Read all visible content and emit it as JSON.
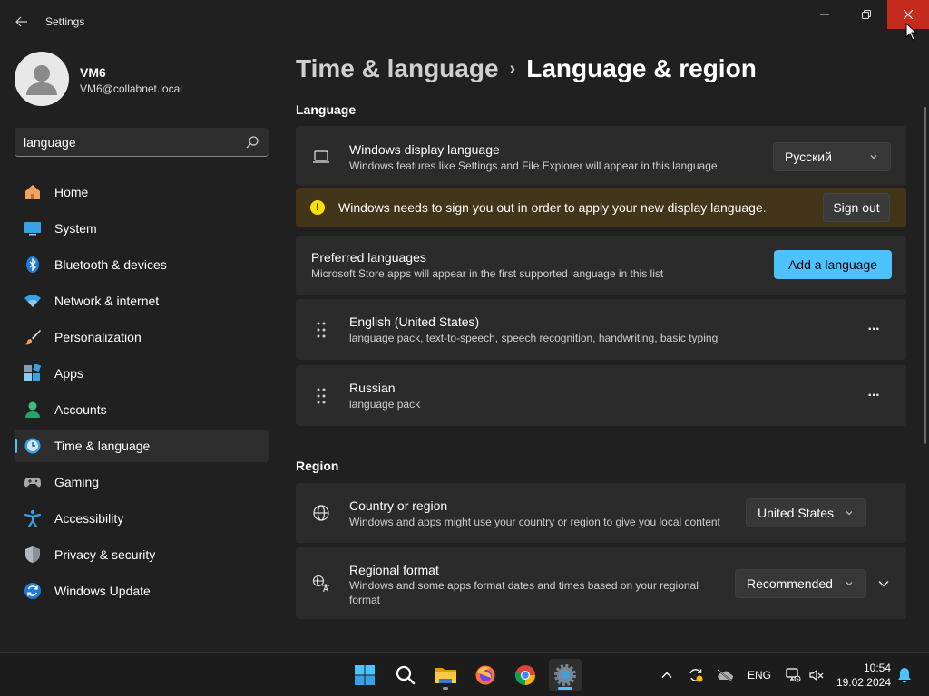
{
  "window": {
    "title": "Settings"
  },
  "user": {
    "name": "VM6",
    "email": "VM6@collabnet.local"
  },
  "search": {
    "value": "language"
  },
  "sidebar": {
    "items": [
      {
        "label": "Home",
        "icon": "home-icon"
      },
      {
        "label": "System",
        "icon": "system-icon"
      },
      {
        "label": "Bluetooth & devices",
        "icon": "bluetooth-icon"
      },
      {
        "label": "Network & internet",
        "icon": "wifi-icon"
      },
      {
        "label": "Personalization",
        "icon": "brush-icon"
      },
      {
        "label": "Apps",
        "icon": "apps-icon"
      },
      {
        "label": "Accounts",
        "icon": "accounts-icon"
      },
      {
        "label": "Time & language",
        "icon": "time-language-icon",
        "active": true
      },
      {
        "label": "Gaming",
        "icon": "gamepad-icon"
      },
      {
        "label": "Accessibility",
        "icon": "accessibility-icon"
      },
      {
        "label": "Privacy & security",
        "icon": "shield-icon"
      },
      {
        "label": "Windows Update",
        "icon": "update-icon"
      }
    ]
  },
  "breadcrumb": {
    "parent": "Time & language",
    "separator": "›",
    "current": "Language & region"
  },
  "language": {
    "section_title": "Language",
    "display_language": {
      "title": "Windows display language",
      "description": "Windows features like Settings and File Explorer will appear in this language",
      "selected": "Русский"
    },
    "warning": {
      "text": "Windows needs to sign you out in order to apply your new display language.",
      "button": "Sign out"
    },
    "preferred": {
      "title": "Preferred languages",
      "description": "Microsoft Store apps will appear in the first supported language in this list",
      "button": "Add a language"
    },
    "languages": [
      {
        "name": "English (United States)",
        "features": "language pack, text-to-speech, speech recognition, handwriting, basic typing"
      },
      {
        "name": "Russian",
        "features": "language pack"
      }
    ],
    "more_glyph": "···"
  },
  "region": {
    "section_title": "Region",
    "country": {
      "title": "Country or region",
      "description": "Windows and apps might use your country or region to give you local content",
      "selected": "United States"
    },
    "format": {
      "title": "Regional format",
      "description_line1": "Windows and some apps format dates and times based on your regional",
      "description_line2": "format",
      "selected": "Recommended"
    }
  },
  "taskbar": {
    "apps": [
      "start-icon",
      "search-icon",
      "file-explorer-icon",
      "firefox-icon",
      "chrome-icon",
      "settings-icon"
    ],
    "language": "ENG",
    "time": "10:54",
    "date": "19.02.2024"
  },
  "colors": {
    "accent": "#4cc2ff",
    "close": "#c42b1c",
    "warning_bg": "#433519",
    "warning_icon": "#fce100"
  }
}
